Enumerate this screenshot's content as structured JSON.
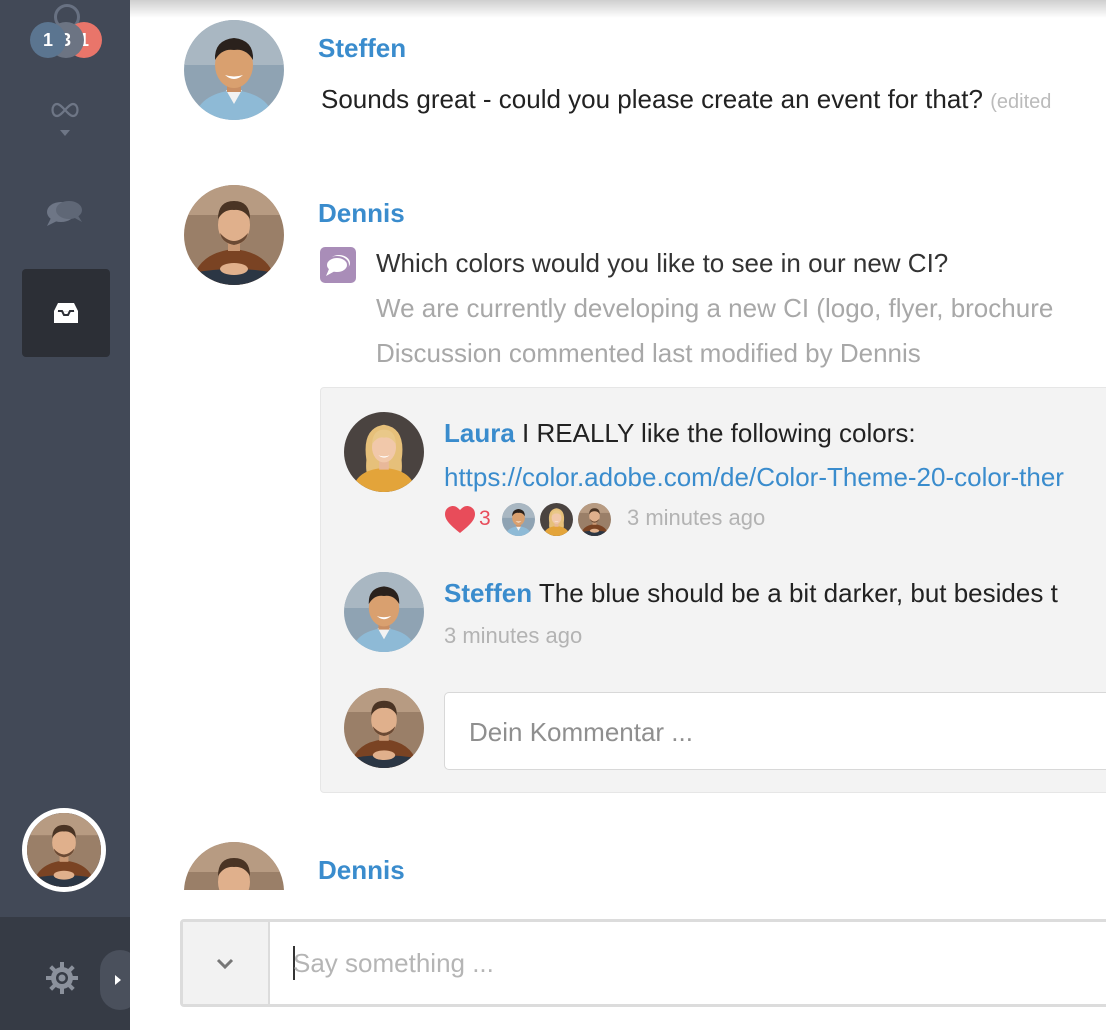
{
  "sidebar": {
    "badges": [
      "1",
      "3",
      "1"
    ]
  },
  "messages": [
    {
      "author": "Steffen",
      "text": "Sounds great - could you please create an event for that?",
      "edited": "(edited"
    },
    {
      "author": "Dennis",
      "title": "Which colors would you like to see in our new CI?",
      "description": "We are currently developing a new CI (logo, flyer, brochure",
      "status": "Discussion commented last modified by Dennis"
    },
    {
      "author": "Dennis"
    }
  ],
  "thread": {
    "comments": [
      {
        "author": "Laura",
        "text": "I REALLY like the following colors:",
        "link": "https://color.adobe.com/de/Color-Theme-20-color-ther",
        "likes": "3",
        "time": "3 minutes ago"
      },
      {
        "author": "Steffen",
        "text": "The blue should be a bit darker, but besides t",
        "time": "3 minutes ago"
      }
    ],
    "comment_placeholder": "Dein Kommentar ..."
  },
  "composer": {
    "placeholder": "Say something ..."
  },
  "colors": {
    "sidebar": "#424957",
    "accent_blue": "#3a8ccd",
    "heart": "#e84c5a",
    "discussion_icon": "#a98db8"
  }
}
